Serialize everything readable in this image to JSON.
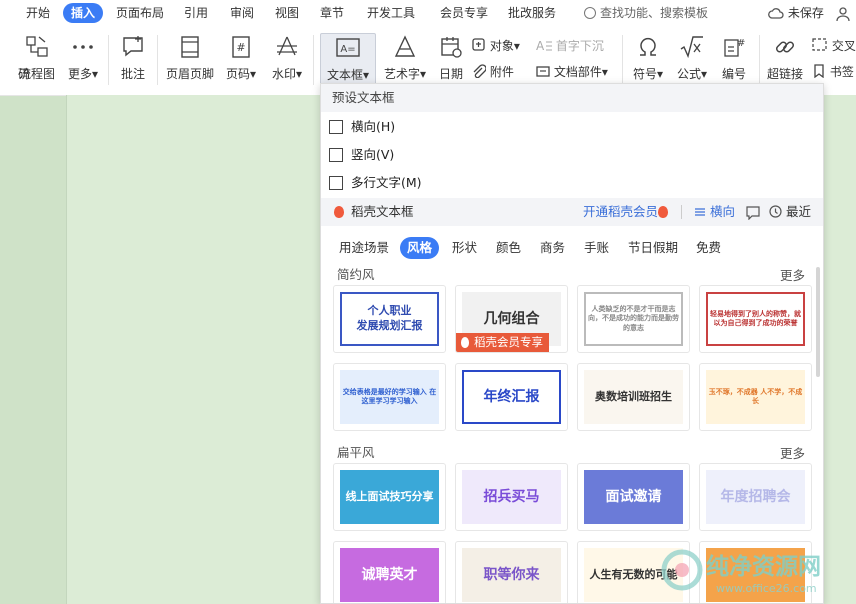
{
  "menubar": {
    "items": [
      "开始",
      "插入",
      "页面布局",
      "引用",
      "审阅",
      "视图",
      "章节",
      "开发工具",
      "会员专享",
      "批改服务"
    ],
    "active": "插入",
    "search_placeholder": "查找功能、搜索模板",
    "save_status": "未保存"
  },
  "ribbon": {
    "tools": [
      {
        "label": "码"
      },
      {
        "label": "流程图"
      },
      {
        "label": "更多▾"
      },
      {
        "label": "批注"
      },
      {
        "label": "页眉页脚"
      },
      {
        "label": "页码▾"
      },
      {
        "label": "水印▾"
      },
      {
        "label": "文本框▾"
      },
      {
        "label": "艺术字▾"
      },
      {
        "label": "日期"
      },
      {
        "label": "符号▾"
      },
      {
        "label": "公式▾"
      },
      {
        "label": "编号"
      },
      {
        "label": "超链接"
      }
    ],
    "small": {
      "object": "对象▾",
      "dropcap": "首字下沉",
      "attachment": "附件",
      "docpart": "文档部件▾",
      "cross": "交叉",
      "bookmark": "书签"
    }
  },
  "panel": {
    "title": "预设文本框",
    "options": [
      "横向(H)",
      "竖向(V)",
      "多行文字(M)"
    ],
    "section_title": "稻壳文本框",
    "vip_link": "开通稻壳会员",
    "orient": "横向",
    "recent": "最近",
    "tabs": [
      "用途场景",
      "风格",
      "形状",
      "颜色",
      "商务",
      "手账",
      "节日假期",
      "免费"
    ],
    "active_tab": "风格",
    "group1": "简约风",
    "group2": "扁平风",
    "more": "更多",
    "cards": [
      {
        "text": "个人职业\n发展规划汇报",
        "color": "#2f4bb0",
        "bg": "#ffffff",
        "border": "#3a57c4"
      },
      {
        "text": "几何组合",
        "color": "#333",
        "bg": "#f1f1f1",
        "badge": "稻壳会员专享"
      },
      {
        "text": "人类缺乏的不是才干而是志向，不是成功的能力而是勤劳的意志",
        "color": "#888",
        "bg": "#ffffff",
        "border": "#bbbbbb"
      },
      {
        "text": "轻易地得到了别人的称赞，就以为自己得到了成功的荣誉",
        "color": "#b33",
        "bg": "#ffffff",
        "border": "#c94141"
      },
      {
        "text": "交给表格是最好的学习输入 在这里学习学习输入",
        "color": "#2e5fd0",
        "bg": "#e4eefc"
      },
      {
        "text": "年终汇报",
        "color": "#2a48c8",
        "bg": "#ffffff",
        "border": "#2a48c8"
      },
      {
        "text": "奥数培训班招生",
        "color": "#333",
        "bg": "#faf6ef"
      },
      {
        "text": "玉不琢，不成器 人不学，不成长",
        "color": "#e0772b",
        "bg": "#fff4dc"
      },
      {
        "text": "线上面试技巧分享",
        "color": "#ffffff",
        "bg": "#3aa8d8"
      },
      {
        "text": "招兵买马",
        "color": "#7a4cd8",
        "bg": "#efe9fb"
      },
      {
        "text": "面试邀请",
        "color": "#ffffff",
        "bg": "#6b7bd8"
      },
      {
        "text": "年度招聘会",
        "color": "#b5b8e8",
        "bg": "#eef0fb"
      },
      {
        "text": "诚聘英才",
        "color": "#ffffff",
        "bg": "#c66be0"
      },
      {
        "text": "职等你来",
        "color": "#7a55c9",
        "bg": "#f4efe6"
      },
      {
        "text": "人生有无数的可能",
        "color": "#333",
        "bg": "#fff8e8"
      },
      {
        "text": "",
        "color": "#333",
        "bg": "#f4a34a"
      }
    ]
  },
  "watermark": {
    "name": "纯净资源网",
    "url": "www.office26.com"
  }
}
